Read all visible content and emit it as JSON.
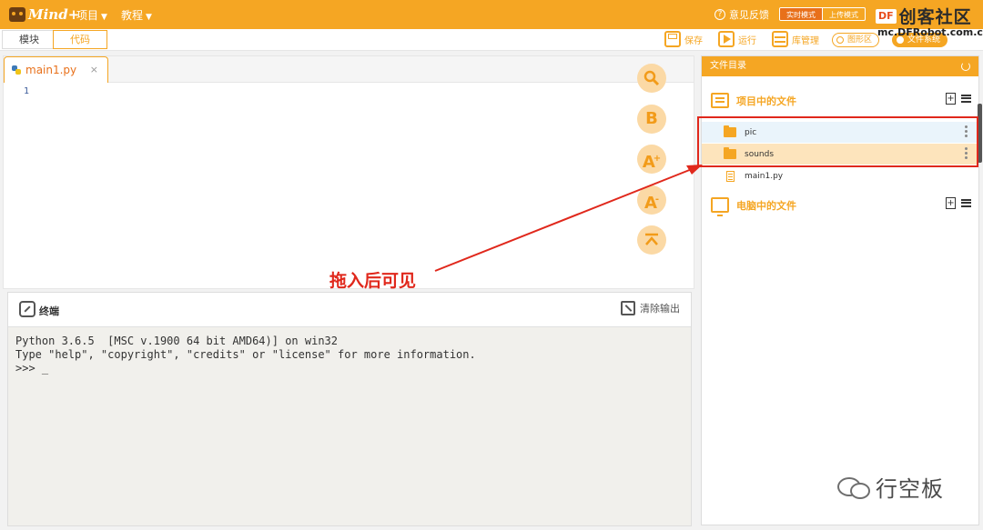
{
  "topbar": {
    "logo_text": "Mind+",
    "menu_project": "项目",
    "menu_tutorial": "教程",
    "feedback": "意见反馈",
    "mode_realtime": "实时模式",
    "mode_upload": "上传模式",
    "watermark_brand": "DF",
    "watermark_title": "创客社区",
    "watermark_url": "mc.DFRobot.com.cn"
  },
  "secondbar": {
    "tab_blocks": "模块",
    "tab_code": "代码",
    "save": "保存",
    "run": "运行",
    "library": "库管理",
    "graphics_area": "图形区",
    "file_system": "文件系统"
  },
  "editor": {
    "file_tab": "main1.py",
    "close_glyph": "×",
    "line_number": "1",
    "fab_letter_b": "B",
    "fab_letter_a": "A",
    "fab_plus": "+",
    "fab_minus": "-"
  },
  "terminal": {
    "title": "终端",
    "clear_label": "清除输出",
    "line1": "Python 3.6.5  [MSC v.1900 64 bit AMD64)] on win32",
    "line2": "Type \"help\", \"copyright\", \"credits\" or \"license\" for more information.",
    "line3": ">>> _"
  },
  "files": {
    "header": "文件目录",
    "project_section": "项目中的文件",
    "computer_section": "电脑中的文件",
    "items": [
      {
        "name": "pic",
        "type": "folder"
      },
      {
        "name": "sounds",
        "type": "folder"
      },
      {
        "name": "main1.py",
        "type": "file"
      }
    ]
  },
  "annotation": {
    "text": "拖入后可见",
    "color": "#e0281c"
  },
  "watermark_bottom": {
    "name": "行空板"
  },
  "colors": {
    "accent": "#f5a623",
    "accent_dark": "#e8701a",
    "highlight_row": "#fde4bc",
    "selected_row": "#eaf4fb"
  },
  "icons": [
    "logo-icon",
    "help-icon",
    "save-icon",
    "run-icon",
    "library-icon",
    "python-file-icon",
    "search-icon",
    "bold-icon",
    "font-increase-icon",
    "font-decrease-icon",
    "collapse-up-icon",
    "terminal-icon",
    "clear-output-icon",
    "refresh-icon",
    "list-icon",
    "monitor-icon",
    "new-file-icon",
    "menu-icon",
    "folder-icon",
    "file-icon",
    "kebab-icon",
    "wechat-icon"
  ]
}
